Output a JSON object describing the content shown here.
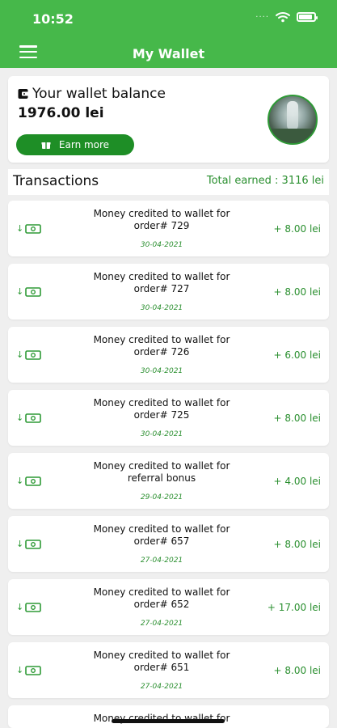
{
  "status_bar": {
    "time": "10:52",
    "signal": "····"
  },
  "app_bar": {
    "title": "My Wallet"
  },
  "balance_card": {
    "label": "Your wallet balance",
    "amount": "1976.00 lei",
    "earn_button_label": "Earn more"
  },
  "transactions_header": {
    "title": "Transactions",
    "total": "Total earned : 3116 lei"
  },
  "transactions": [
    {
      "line1": "Money credited to wallet for",
      "line2": "order# 729",
      "date": "30-04-2021",
      "amount": "+ 8.00 lei"
    },
    {
      "line1": "Money credited to wallet for",
      "line2": "order# 727",
      "date": "30-04-2021",
      "amount": "+ 8.00 lei"
    },
    {
      "line1": "Money credited to wallet for",
      "line2": "order# 726",
      "date": "30-04-2021",
      "amount": "+ 6.00 lei"
    },
    {
      "line1": "Money credited to wallet for",
      "line2": "order# 725",
      "date": "30-04-2021",
      "amount": "+ 8.00 lei"
    },
    {
      "line1": "Money credited to wallet for",
      "line2": "referral bonus",
      "date": "29-04-2021",
      "amount": "+ 4.00 lei"
    },
    {
      "line1": "Money credited to wallet for",
      "line2": "order# 657",
      "date": "27-04-2021",
      "amount": "+ 8.00 lei"
    },
    {
      "line1": "Money credited to wallet for",
      "line2": "order# 652",
      "date": "27-04-2021",
      "amount": "+ 17.00 lei"
    },
    {
      "line1": "Money credited to wallet for",
      "line2": "order# 651",
      "date": "27-04-2021",
      "amount": "+ 8.00 lei"
    },
    {
      "line1": "Money credited to wallet for",
      "line2": "",
      "date": "",
      "amount": ""
    }
  ],
  "icons": {
    "menu": "menu-icon",
    "wallet": "wallet-icon",
    "gift": "gift-icon",
    "transaction": "money-in-icon",
    "wifi": "wifi-icon",
    "battery": "battery-icon"
  },
  "colors": {
    "header_green": "#46b84a",
    "button_green": "#1e8e26",
    "accent_green": "#2a8f2f",
    "background": "#efefef"
  }
}
